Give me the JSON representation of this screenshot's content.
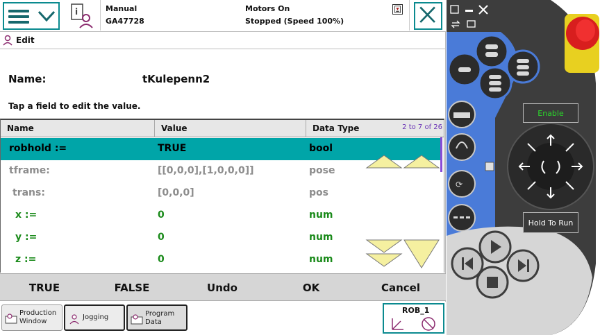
{
  "topbar": {
    "mode": "Manual",
    "controller": "GA47728",
    "motors": "Motors On",
    "state": "Stopped (Speed 100%)"
  },
  "edit_tab": {
    "label": "Edit"
  },
  "form": {
    "name_label": "Name:",
    "name_value": "tKulepenn2",
    "hint": "Tap a field to edit the value."
  },
  "table": {
    "columns": [
      "Name",
      "Value",
      "Data Type"
    ],
    "page_indicator": "2 to 7 of 26",
    "rows": [
      {
        "name": "robhold :=",
        "value": "TRUE",
        "type": "bool",
        "style": "sel"
      },
      {
        "name": "tframe:",
        "value": "[[0,0,0],[1,0,0,0]]",
        "type": "pose",
        "style": "gray"
      },
      {
        "name": "trans:",
        "value": "[0,0,0]",
        "type": "pos",
        "style": "gray"
      },
      {
        "name": "x :=",
        "value": "0",
        "type": "num",
        "style": "green"
      },
      {
        "name": "y :=",
        "value": "0",
        "type": "num",
        "style": "green"
      },
      {
        "name": "z :=",
        "value": "0",
        "type": "num",
        "style": "green"
      }
    ]
  },
  "commands": [
    "TRUE",
    "FALSE",
    "Undo",
    "OK",
    "Cancel"
  ],
  "taskbar": {
    "items": [
      {
        "label1": "Production",
        "label2": "Window"
      },
      {
        "label1": "Jogging",
        "label2": ""
      },
      {
        "label1": "Program",
        "label2": "Data"
      }
    ],
    "robot": "ROB_1"
  },
  "pendant": {
    "enable_label": "Enable",
    "hold_to_run_label": "Hold To Run"
  },
  "colors": {
    "accent": "#0a8a8f",
    "selected_row": "#00a5a8",
    "editable_text": "#1a8a1a",
    "readonly_text": "#8c8c8c",
    "pendant_body": "#3a3a3a",
    "pendant_blue": "#4a7bd8",
    "emergency_red": "#e02424",
    "scroll_arrow": "#f5f0a0"
  }
}
